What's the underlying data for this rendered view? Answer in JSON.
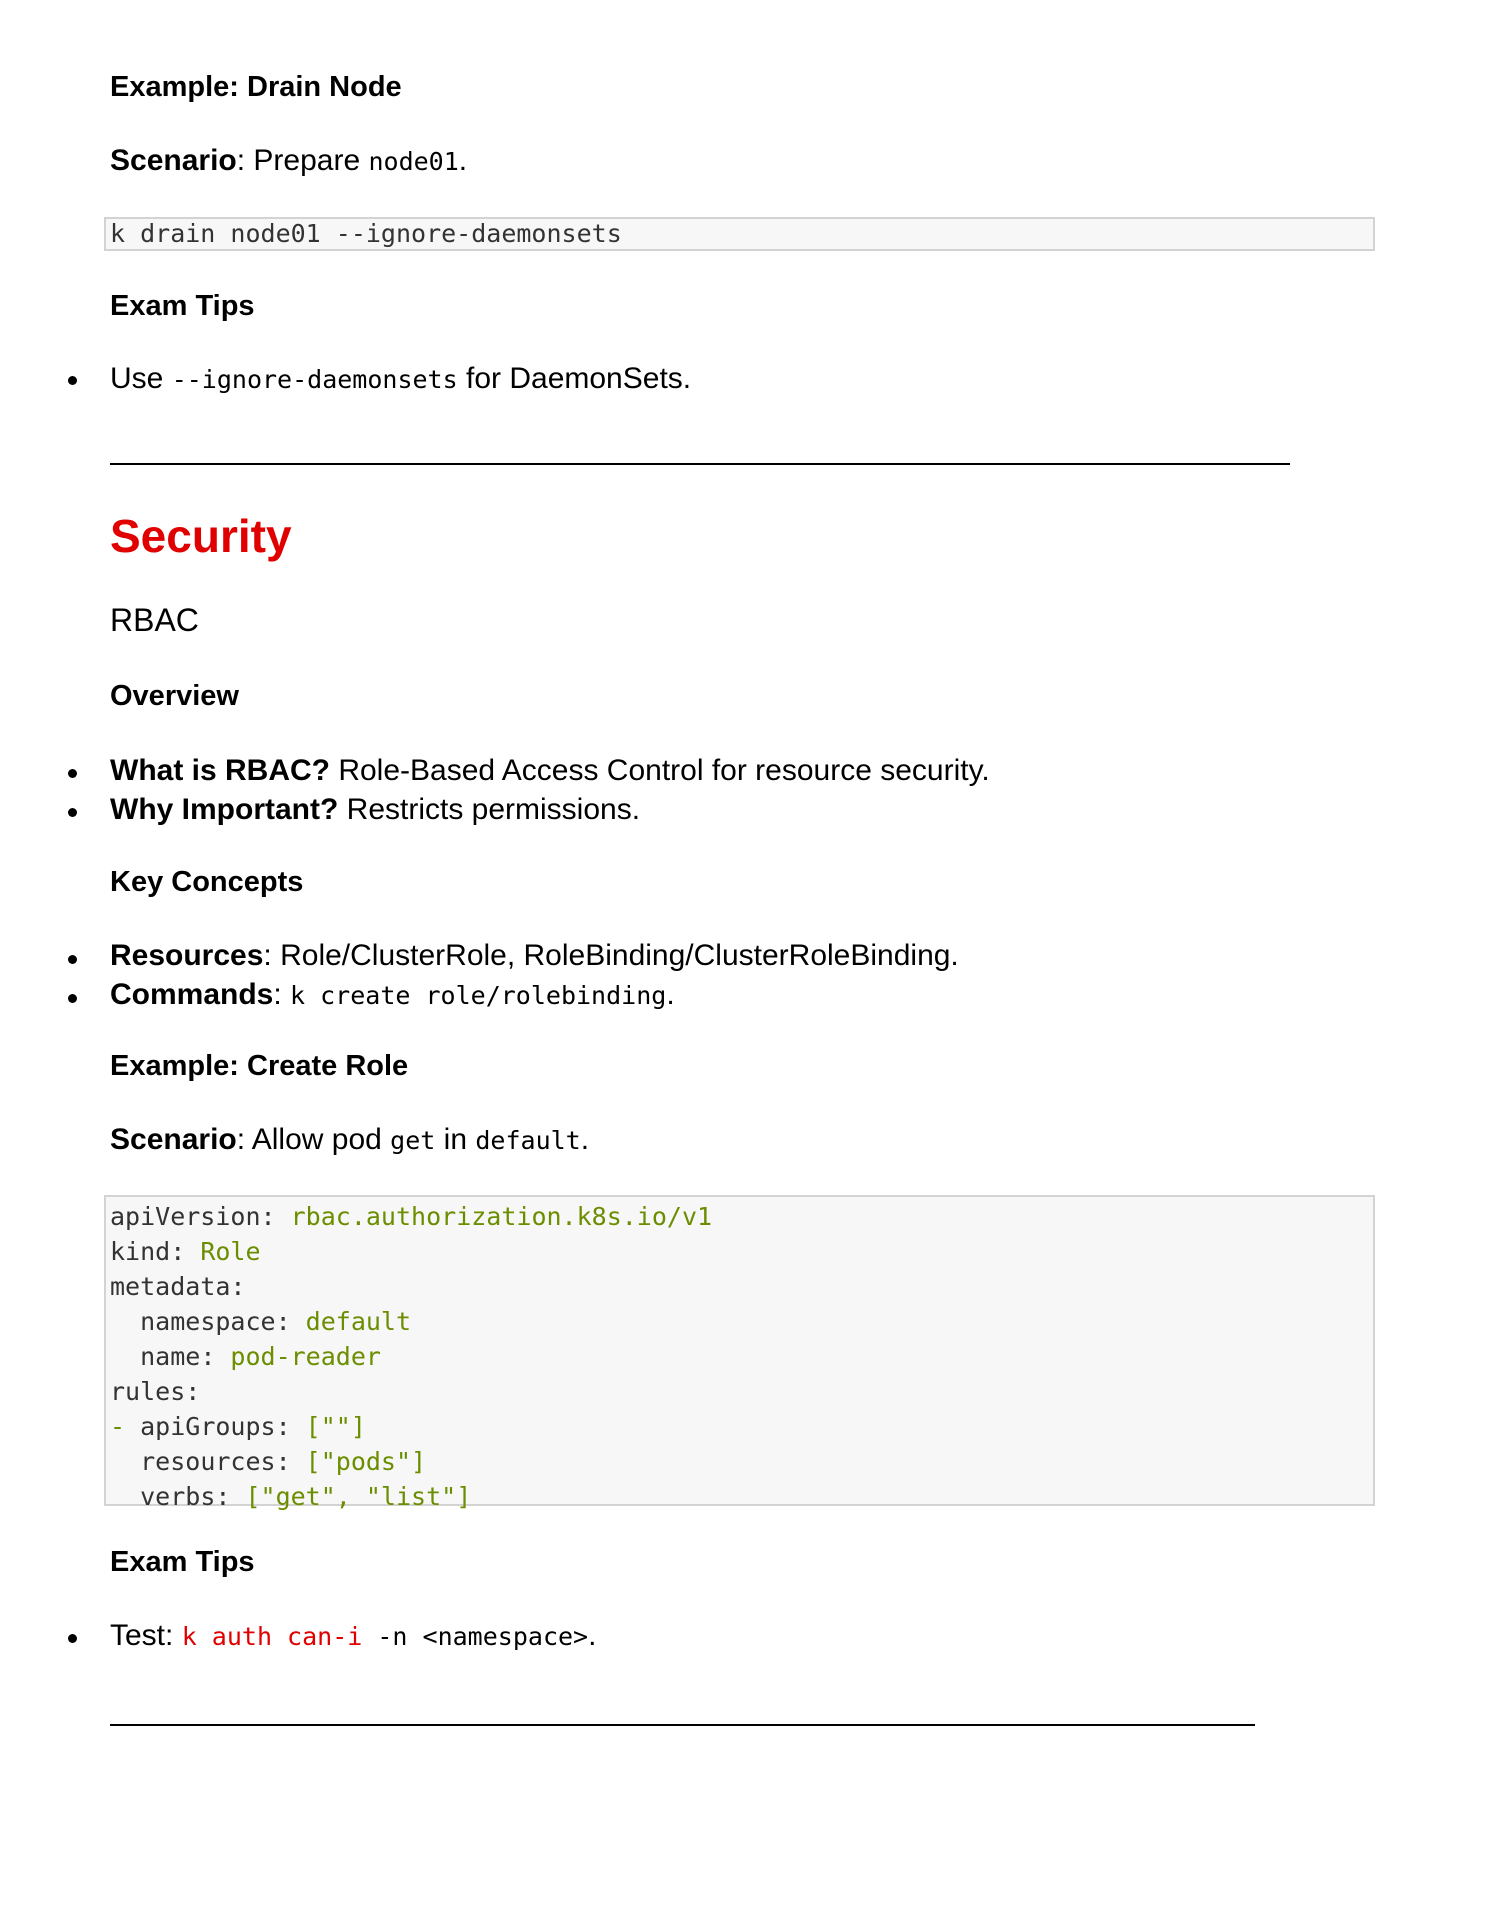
{
  "drain": {
    "heading": "Example: Drain Node",
    "scenario_label": "Scenario",
    "scenario_sep": ": Prepare ",
    "scenario_code": "node01",
    "scenario_end": ".",
    "code": "k drain node01 --ignore-daemonsets",
    "tips_heading": "Exam Tips",
    "tip_prefix": "Use ",
    "tip_code": "--ignore-daemonsets",
    "tip_suffix": " for DaemonSets."
  },
  "security": {
    "title": "Security",
    "subtitle": "RBAC",
    "overview_heading": "Overview",
    "overview": [
      {
        "bold": "What is RBAC?",
        "text": " Role-Based Access Control for resource security."
      },
      {
        "bold": "Why Important?",
        "text": " Restricts permissions."
      }
    ],
    "concepts_heading": "Key Concepts",
    "concept_resources_bold": "Resources",
    "concept_resources_text": ": Role/ClusterRole, RoleBinding/ClusterRoleBinding.",
    "concept_commands_bold": "Commands",
    "concept_commands_sep": ": ",
    "concept_commands_code": "k create role/rolebinding",
    "concept_commands_end": ".",
    "example_heading": "Example: Create Role",
    "scenario_label": "Scenario",
    "scenario_text1": ": Allow pod ",
    "scenario_code1": "get",
    "scenario_text2": " in ",
    "scenario_code2": "default",
    "scenario_end": ".",
    "yaml": [
      {
        "indent": "",
        "key": "apiVersion:",
        "value": " rbac.authorization.k8s.io/v1"
      },
      {
        "indent": "",
        "key": "kind:",
        "value": " Role"
      },
      {
        "indent": "",
        "key": "metadata:",
        "value": ""
      },
      {
        "indent": "  ",
        "key": "namespace:",
        "value": " default"
      },
      {
        "indent": "  ",
        "key": "name:",
        "value": " pod-reader"
      },
      {
        "indent": "",
        "key": "rules:",
        "value": ""
      },
      {
        "indent": "- ",
        "key": "apiGroups:",
        "value": " [\"\"]"
      },
      {
        "indent": "  ",
        "key": "resources:",
        "value": " [\"pods\"]"
      },
      {
        "indent": "  ",
        "key": "verbs:",
        "value": " [\"get\", \"list\"]"
      }
    ],
    "tips_heading": "Exam Tips",
    "tip_prefix": "Test: ",
    "tip_code_red": "k auth can-i",
    "tip_code_rest": " -n <namespace>",
    "tip_end": "."
  }
}
